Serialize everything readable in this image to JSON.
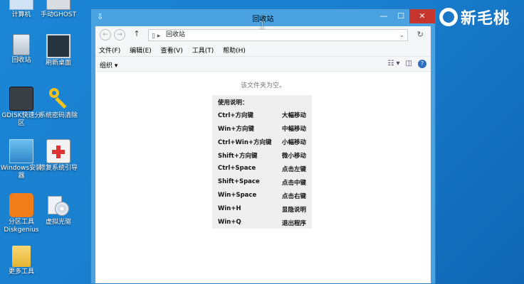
{
  "desktop": {
    "icons": [
      {
        "label": "计算机"
      },
      {
        "label": "手动GHOST"
      },
      {
        "label": "回收站"
      },
      {
        "label": "刷新桌面"
      },
      {
        "label": "GDISK快速分区"
      },
      {
        "label": "系统密码清除"
      },
      {
        "label": "Windows安装器"
      },
      {
        "label": "修复系统引导"
      },
      {
        "label": "分区工具Diskgenius"
      },
      {
        "label": "虚拟光驱"
      },
      {
        "label": "更多工具"
      }
    ]
  },
  "brand": {
    "text": "新毛桃"
  },
  "window": {
    "title": "回收站",
    "address": "回收站",
    "menu": [
      "文件(F)",
      "编辑(E)",
      "查看(V)",
      "工具(T)",
      "帮助(H)"
    ],
    "organize_label": "组织 ▾",
    "empty_message": "该文件夹为空。"
  },
  "help": {
    "title": "使用说明：",
    "rows": [
      {
        "key": "Ctrl+方向键",
        "action": "大幅移动"
      },
      {
        "key": "Win+方向键",
        "action": "中幅移动"
      },
      {
        "key": "Ctrl+Win+方向键",
        "action": "小幅移动"
      },
      {
        "key": "Shift+方向键",
        "action": "微小移动"
      },
      {
        "key": "Ctrl+Space",
        "action": "点击左键"
      },
      {
        "key": "Shift+Space",
        "action": "点击中键"
      },
      {
        "key": "Win+Space",
        "action": "点击右键"
      },
      {
        "key": "Win+H",
        "action": "显隐说明"
      },
      {
        "key": "Win+Q",
        "action": "退出程序"
      }
    ]
  },
  "colors": {
    "desktop": "#1a78c4",
    "close_button": "#c7362e",
    "titlebar": "#4aa3e0"
  }
}
